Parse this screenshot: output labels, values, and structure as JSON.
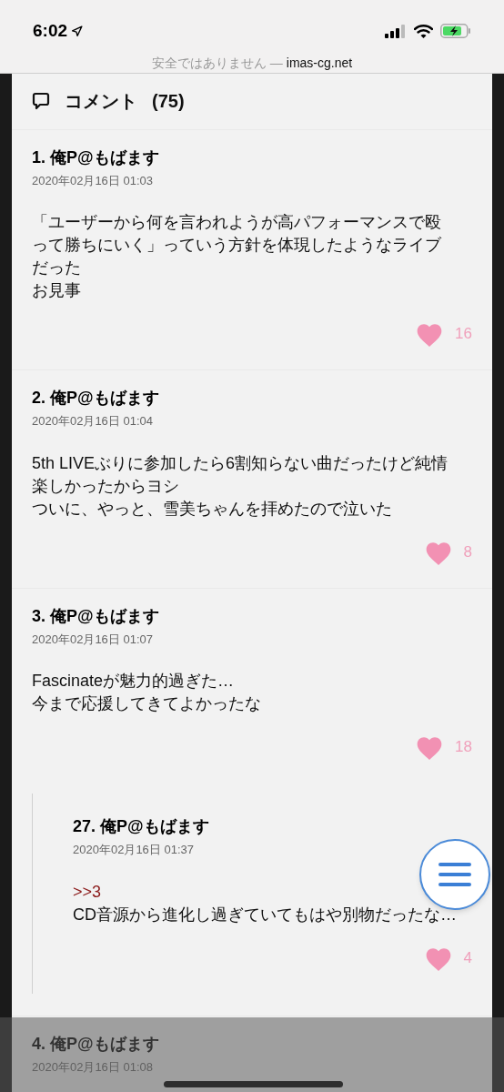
{
  "status_bar": {
    "time": "6:02"
  },
  "address_bar": {
    "security": "安全ではありません —",
    "domain": "imas-cg.net"
  },
  "section": {
    "title": "コメント",
    "count": "(75)"
  },
  "comments": [
    {
      "number": "1.",
      "author": "俺P@もばます",
      "date": "2020年02月16日 01:03",
      "body": [
        "「ユーザーから何を言われようが高パフォーマンスで殴",
        "って勝ちにいく」っていう方針を体現したようなライブ",
        "だった",
        "お見事"
      ],
      "likes": "16"
    },
    {
      "number": "2.",
      "author": "俺P@もばます",
      "date": "2020年02月16日 01:04",
      "body": [
        "5th LIVEぶりに参加したら6割知らない曲だったけど純情",
        "楽しかったからヨシ",
        "ついに、やっと、雪美ちゃんを拝めたので泣いた"
      ],
      "likes": "8"
    },
    {
      "number": "3.",
      "author": "俺P@もばます",
      "date": "2020年02月16日 01:07",
      "body": [
        "Fascinateが魅力的過ぎた…",
        "今まで応援してきてよかったな"
      ],
      "likes": "18",
      "replies": [
        {
          "number": "27.",
          "author": "俺P@もばます",
          "date": "2020年02月16日 01:37",
          "reply_to": ">>3",
          "body": [
            "CD音源から進化し過ぎていてもはや別物だったな…"
          ],
          "likes": "4"
        }
      ]
    },
    {
      "number": "4.",
      "author": "俺P@もばます",
      "date": "2020年02月16日 01:08"
    }
  ]
}
